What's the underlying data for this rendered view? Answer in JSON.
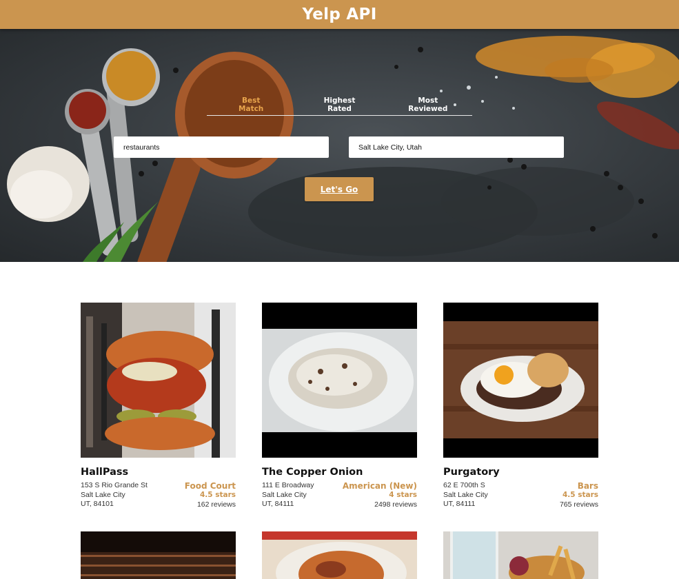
{
  "header": {
    "title": "Yelp API"
  },
  "search": {
    "tabs": [
      {
        "label": "Best\nMatch",
        "active": true
      },
      {
        "label": "Highest\nRated",
        "active": false
      },
      {
        "label": "Most\nReviewed",
        "active": false
      }
    ],
    "term_value": "restaurants",
    "location_value": "Salt Lake City, Utah",
    "submit_label": "Let's Go"
  },
  "businesses": [
    {
      "name": "HallPass",
      "address1": "153 S Rio Grande St",
      "city": "Salt Lake City",
      "state_zip": "UT, 84101",
      "category": "Food Court",
      "rating": "4.5 stars",
      "reviews": "162 reviews"
    },
    {
      "name": "The Copper Onion",
      "address1": "111 E Broadway",
      "city": "Salt Lake City",
      "state_zip": "UT, 84111",
      "category": "American (New)",
      "rating": "4 stars",
      "reviews": "2498 reviews"
    },
    {
      "name": "Purgatory",
      "address1": "62 E 700th S",
      "city": "Salt Lake City",
      "state_zip": "UT, 84111",
      "category": "Bars",
      "rating": "4.5 stars",
      "reviews": "765 reviews"
    }
  ],
  "colors": {
    "accent": "#cb954f",
    "active_tab": "#e9a54c"
  }
}
